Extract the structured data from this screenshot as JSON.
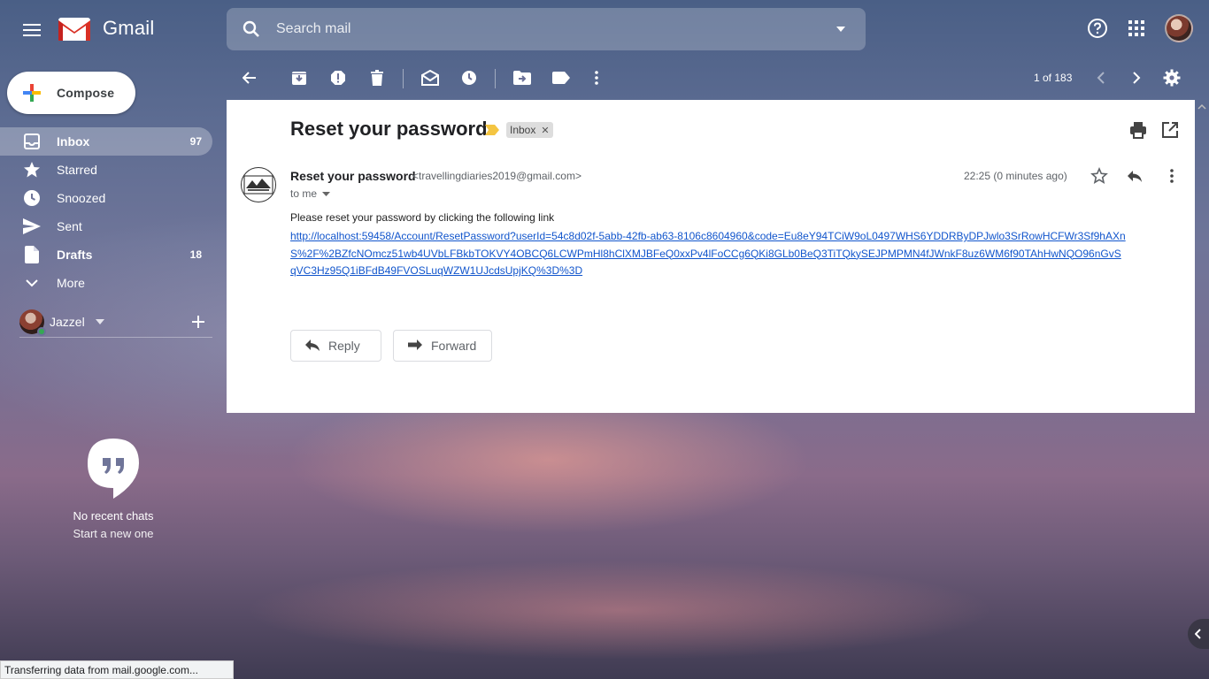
{
  "app": {
    "name": "Gmail"
  },
  "search": {
    "placeholder": "Search mail"
  },
  "compose": {
    "label": "Compose"
  },
  "sidebar": {
    "items": [
      {
        "label": "Inbox",
        "count": "97",
        "icon": "inbox-icon",
        "active": true
      },
      {
        "label": "Starred",
        "count": "",
        "icon": "star-icon"
      },
      {
        "label": "Snoozed",
        "count": "",
        "icon": "clock-icon"
      },
      {
        "label": "Sent",
        "count": "",
        "icon": "send-icon"
      },
      {
        "label": "Drafts",
        "count": "18",
        "icon": "draft-icon"
      },
      {
        "label": "More",
        "count": "",
        "icon": "chevron-down-icon"
      }
    ]
  },
  "hangouts": {
    "user": "Jazzel",
    "empty_title": "No recent chats",
    "empty_action": "Start a new one"
  },
  "toolbar": {
    "pager": "1 of 183",
    "icons": [
      "back-icon",
      "archive-icon",
      "report-spam-icon",
      "delete-icon",
      "mark-unread-icon",
      "snooze-icon",
      "move-to-icon",
      "labels-icon",
      "more-icon",
      "prev-icon",
      "next-icon",
      "settings-icon"
    ]
  },
  "email": {
    "subject": "Reset your password",
    "label": "Inbox",
    "sender_name": "Reset your password",
    "sender_email": "<travellingdiaries2019@gmail.com>",
    "to": "to me",
    "time": "22:25 (0 minutes ago)",
    "body": "Please reset your password by clicking the following link",
    "link": "http://localhost:59458/Account/ResetPassword?userId=54c8d02f-5abb-42fb-ab63-8106c8604960&code=Eu8eY94TCiW9oL0497WHS6YDDRByDPJwlo3SrRowHCFWr3Sf9hAXnS%2F%2BZfcNOmcz51wb4UVbLFBkbTOKVY4OBCQ6LCWPmHl8hClXMJBFeQ0xxPv4lFoCCg6QKi8GLb0BeQ3TiTQkySEJPMPMN4fJWnkF8uz6WM6f90TAhHwNQO96nGvSqVC3Hz95Q1iBFdB49FVOSLuqWZW1UJcdsUpjKQ%3D%3D",
    "reply_label": "Reply",
    "forward_label": "Forward"
  },
  "status_bar": {
    "text": "Transferring data from mail.google.com..."
  },
  "colors": {
    "link": "#1155cc",
    "important": "#f4c542",
    "online": "#34a853"
  }
}
